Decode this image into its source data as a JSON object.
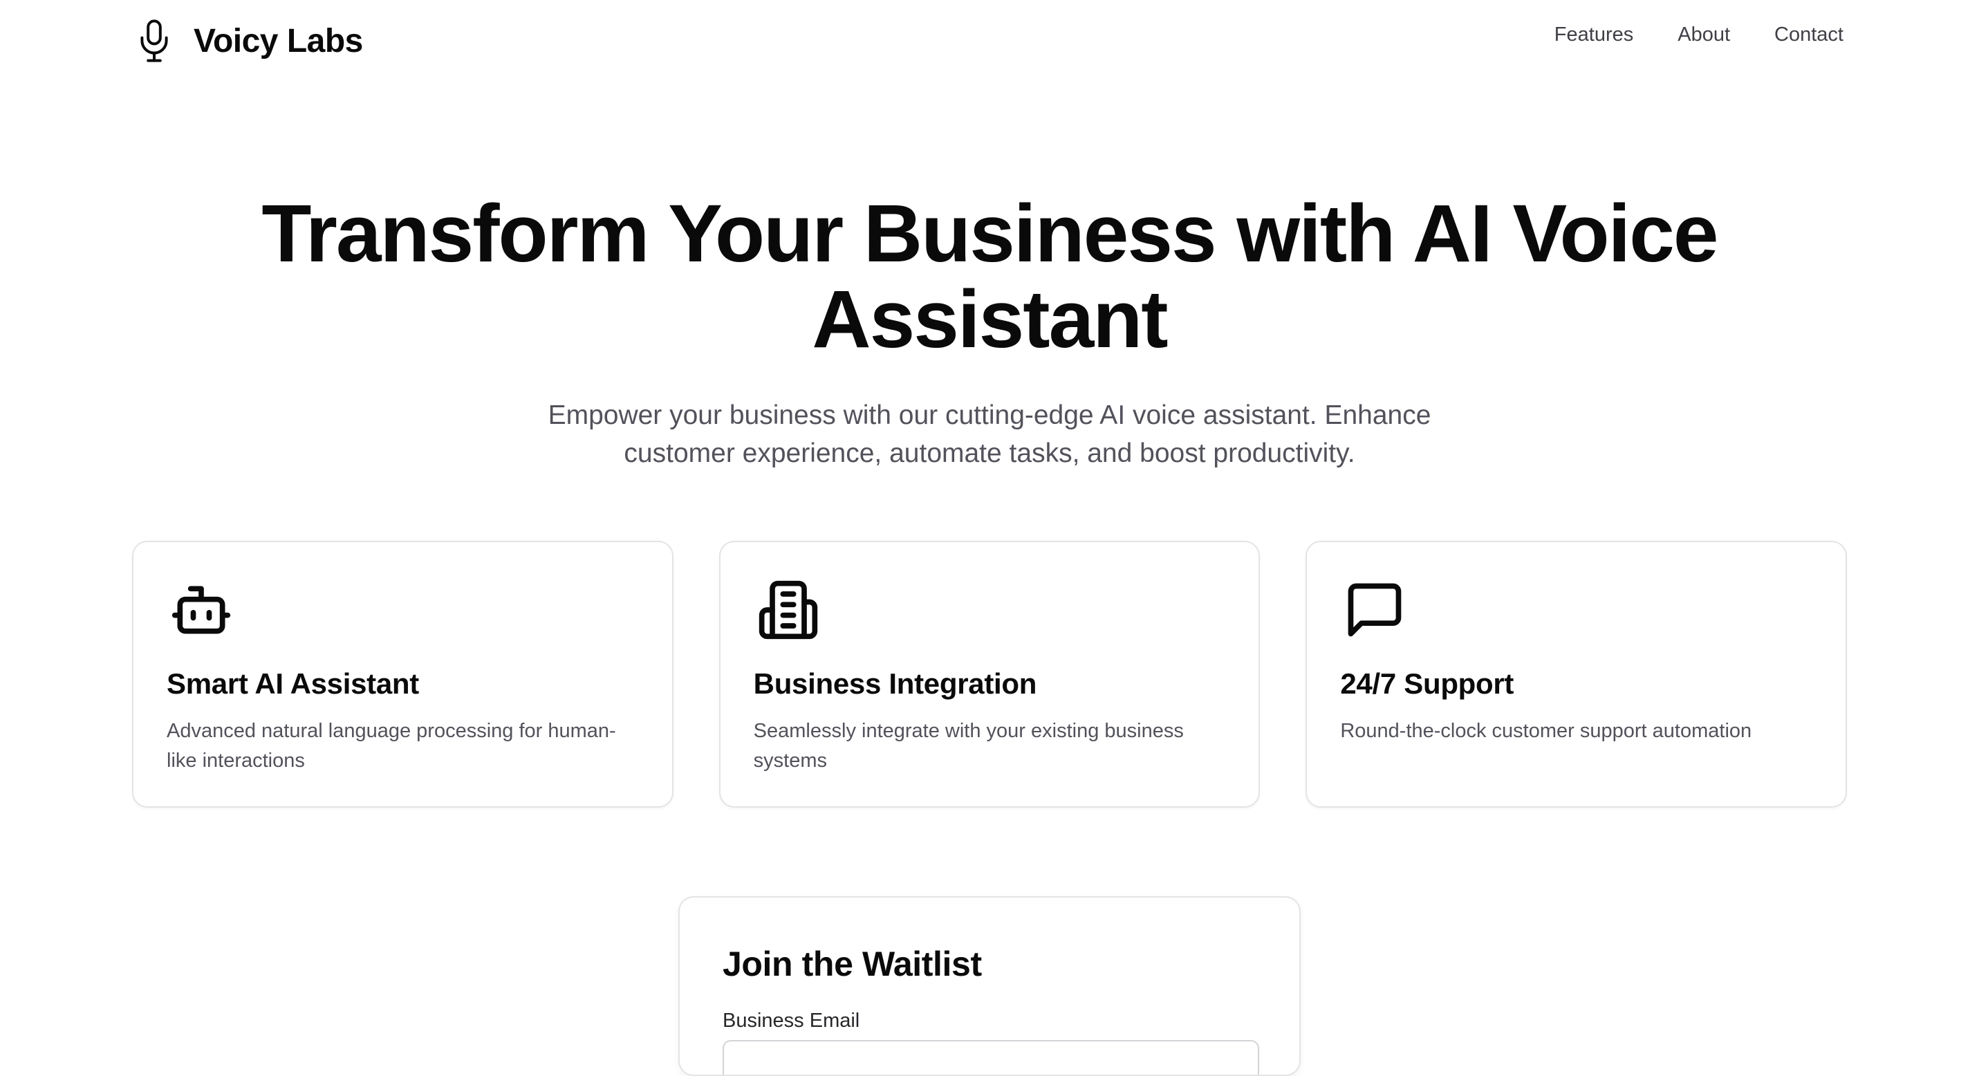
{
  "header": {
    "brand_name": "Voicy Labs",
    "brand_icon": "microphone-icon",
    "nav": [
      {
        "label": "Features"
      },
      {
        "label": "About"
      },
      {
        "label": "Contact"
      }
    ]
  },
  "hero": {
    "title_line1": "Transform Your Business with AI Voice",
    "title_line2": "Assistant",
    "subtitle_line1": "Empower your business with our cutting-edge AI voice assistant. Enhance",
    "subtitle_line2": "customer experience, automate tasks, and boost productivity."
  },
  "features": [
    {
      "icon": "robot-icon",
      "title": "Smart AI Assistant",
      "desc_line1": "Advanced natural language processing for human-",
      "desc_line2": "like interactions"
    },
    {
      "icon": "building-icon",
      "title": "Business Integration",
      "desc_line1": "Seamlessly integrate with your existing business",
      "desc_line2": "systems"
    },
    {
      "icon": "message-square-icon",
      "title": "24/7 Support",
      "desc_line1": "Round-the-clock customer support automation",
      "desc_line2": ""
    }
  ],
  "waitlist": {
    "title": "Join the Waitlist",
    "email_label": "Business Email",
    "email_value": "",
    "email_placeholder": ""
  },
  "colors": {
    "text_primary": "#0a0a0a",
    "text_muted": "#52525b",
    "nav_text": "#3f3f46",
    "card_border": "#e4e4e7",
    "background": "#ffffff"
  }
}
